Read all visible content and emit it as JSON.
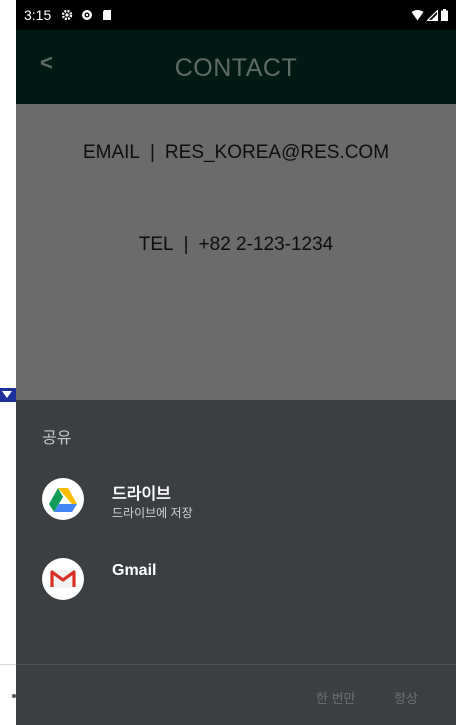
{
  "status_bar": {
    "time": "3:15",
    "icons_left": [
      "settings-icon",
      "vpn-icon",
      "sd-card-icon"
    ],
    "icons_right": [
      "wifi-icon",
      "signal-icon",
      "battery-icon"
    ]
  },
  "app_bar": {
    "back_label": "<",
    "title": "CONTACT"
  },
  "contact": {
    "email_label": "EMAIL",
    "separator": "|",
    "email_value": "RES_KOREA@RES.COM",
    "tel_label": "TEL",
    "tel_value": "+82 2-123-1234"
  },
  "share_sheet": {
    "title": "공유",
    "options": [
      {
        "name": "드라이브",
        "subtitle": "드라이브에 저장",
        "icon": "google-drive-icon"
      },
      {
        "name": "Gmail",
        "subtitle": "",
        "icon": "gmail-icon"
      }
    ],
    "just_once_label": "한 번만",
    "always_label": "항상"
  },
  "colors": {
    "status_bar": "#000000",
    "app_bar": "#011a14",
    "content_bg": "#6b6b6b",
    "sheet_bg": "#3b3f42"
  }
}
